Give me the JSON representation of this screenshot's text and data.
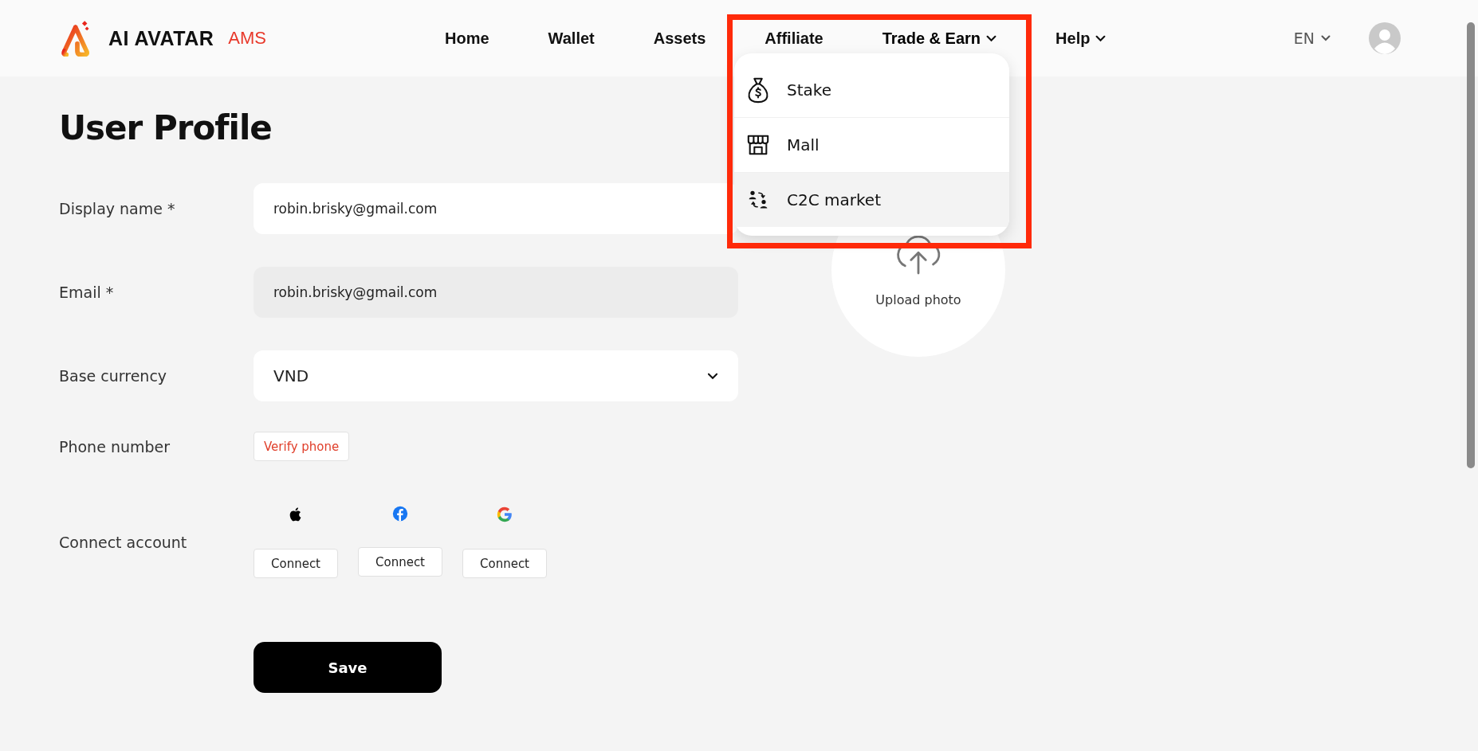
{
  "logo": {
    "name": "AI AVATAR",
    "tag": "AMS"
  },
  "nav": [
    {
      "label": "Home",
      "has_menu": false,
      "expanded": false
    },
    {
      "label": "Wallet",
      "has_menu": false,
      "expanded": false
    },
    {
      "label": "Assets",
      "has_menu": false,
      "expanded": false
    },
    {
      "label": "Affiliate",
      "has_menu": false,
      "expanded": false
    },
    {
      "label": "Trade & Earn",
      "has_menu": true,
      "expanded": true
    },
    {
      "label": "Help",
      "has_menu": true,
      "expanded": false
    }
  ],
  "dropdown": [
    {
      "label": "Stake",
      "kind": "stake",
      "selected": false
    },
    {
      "label": "Mall",
      "kind": "mall",
      "selected": false
    },
    {
      "label": "C2C market",
      "kind": "exchange",
      "selected": true
    }
  ],
  "language": "EN",
  "page_title": "User Profile",
  "form": {
    "display_name": {
      "label": "Display name *",
      "value": "robin.brisky@gmail.com",
      "disabled": false
    },
    "email": {
      "label": "Email *",
      "value": "robin.brisky@gmail.com",
      "disabled": true
    },
    "base_currency": {
      "label": "Base currency",
      "value": "VND"
    },
    "phone": {
      "label": "Phone number",
      "button": "Verify phone"
    },
    "connect": {
      "label": "Connect account",
      "accounts": [
        {
          "kind": "apple",
          "button": "Connect"
        },
        {
          "kind": "facebook",
          "button": "Connect"
        },
        {
          "kind": "google",
          "button": "Connect"
        }
      ]
    },
    "save": "Save"
  },
  "upload": {
    "label": "Upload photo"
  }
}
